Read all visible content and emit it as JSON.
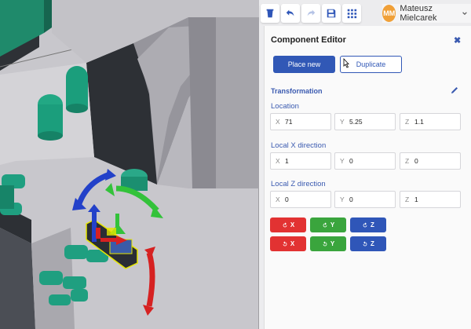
{
  "toolbar": {
    "buttons": [
      {
        "icon": "trash-icon",
        "enabled": true
      },
      {
        "icon": "undo-icon",
        "enabled": true
      },
      {
        "icon": "redo-icon",
        "enabled": false
      },
      {
        "icon": "save-icon",
        "enabled": true
      },
      {
        "icon": "grid-icon",
        "enabled": true
      }
    ]
  },
  "user": {
    "initials": "MM",
    "name": "Mateusz Mielcarek"
  },
  "panel": {
    "title": "Component Editor",
    "close_label": "✖",
    "place_new_label": "Place new",
    "duplicate_label": "Duplicate",
    "transformation_label": "Transformation",
    "location": {
      "label": "Location",
      "x_label": "X",
      "x": "71",
      "y_label": "Y",
      "y": "5.25",
      "z_label": "Z",
      "z": "1.1"
    },
    "local_x": {
      "label": "Local X direction",
      "x_label": "X",
      "x": "1",
      "y_label": "Y",
      "y": "0",
      "z_label": "Z",
      "z": "0"
    },
    "local_z": {
      "label": "Local Z direction",
      "x_label": "X",
      "x": "0",
      "y_label": "Y",
      "y": "0",
      "z_label": "Z",
      "z": "1"
    },
    "rotate": {
      "row1": {
        "x": "X",
        "y": "Y",
        "z": "Z"
      },
      "row2": {
        "x": "X",
        "y": "Y",
        "z": "Z"
      }
    }
  },
  "colors": {
    "accent": "#3158b6",
    "rotate_x": "#e23232",
    "rotate_y": "#3aa53d",
    "rotate_z": "#2f56b8",
    "avatar": "#f0a038"
  }
}
